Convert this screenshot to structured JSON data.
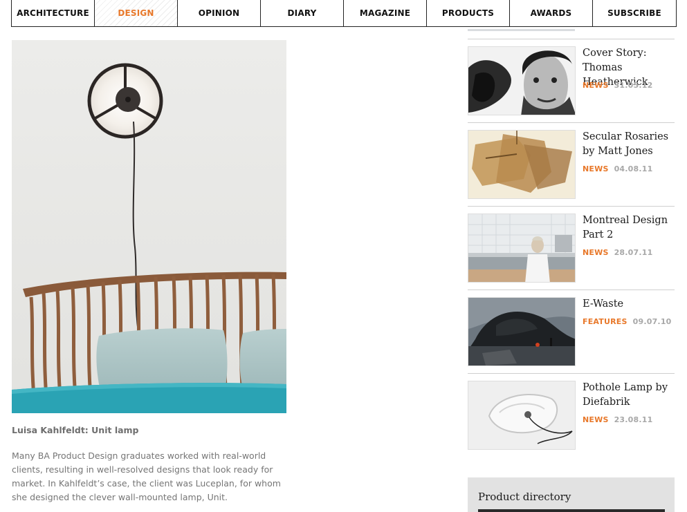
{
  "nav": {
    "items": [
      {
        "label": "ARCHITECTURE"
      },
      {
        "label": "DESIGN"
      },
      {
        "label": "OPINION"
      },
      {
        "label": "DIARY"
      },
      {
        "label": "MAGAZINE"
      },
      {
        "label": "PRODUCTS"
      },
      {
        "label": "AWARDS"
      },
      {
        "label": "SUBSCRIBE"
      }
    ],
    "active": "DESIGN"
  },
  "article": {
    "caption": "Luisa Kahlfeldt: Unit lamp",
    "body": "Many BA Product Design graduates worked with real-world clients, resulting in well-resolved designs that look ready for market. In Kahlfeldt’s case, the client was Luceplan, for whom she designed the clever wall-mounted lamp, Unit."
  },
  "sidebar": {
    "items": [
      {
        "title": "Cover Story: Thomas Heatherwick",
        "category": "NEWS",
        "date": "31.05.12"
      },
      {
        "title": "Secular Rosaries by Matt Jones",
        "category": "NEWS",
        "date": "04.08.11"
      },
      {
        "title": "Montreal Design Part 2",
        "category": "NEWS",
        "date": "28.07.11"
      },
      {
        "title": "E-Waste",
        "category": "FEATURES",
        "date": "09.07.10"
      },
      {
        "title": "Pothole Lamp by Diefabrik",
        "category": "NEWS",
        "date": "23.08.11"
      }
    ],
    "product_directory": {
      "title": "Product directory"
    }
  },
  "colors": {
    "accent": "#e8782a",
    "date_grey": "#a8a8a8",
    "body_grey": "#757575"
  }
}
